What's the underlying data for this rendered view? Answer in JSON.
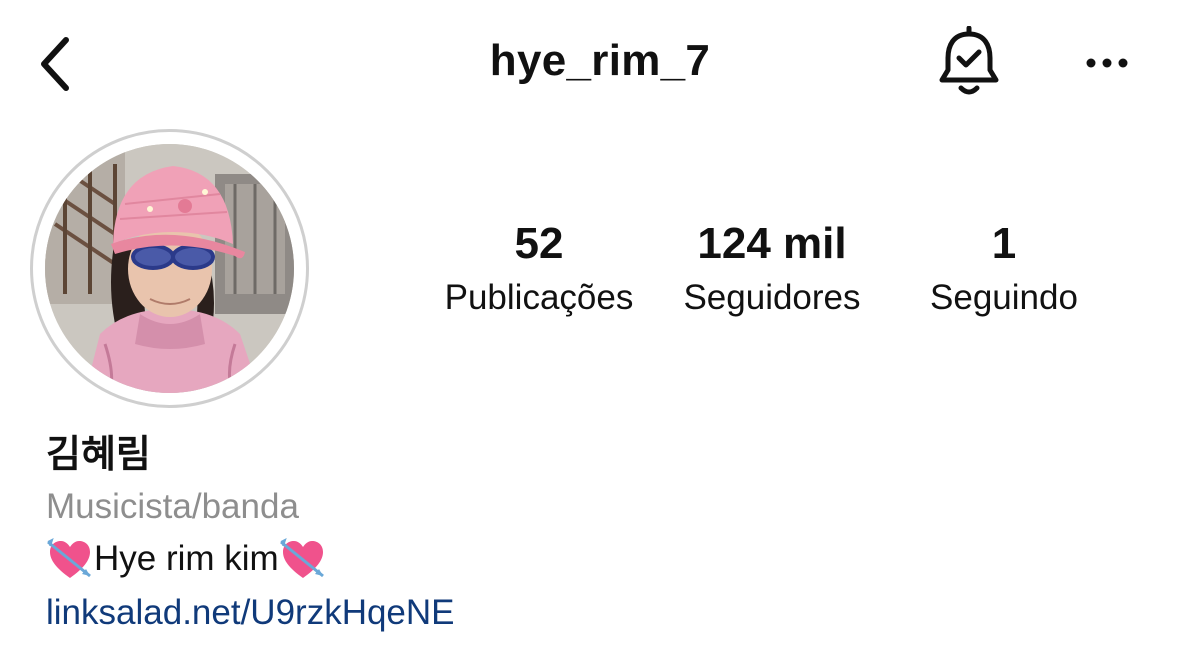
{
  "header": {
    "username": "hye_rim_7",
    "back_icon": "chevron-left-icon",
    "bell_icon": "bell-check-icon",
    "more_icon": "more-horizontal-icon"
  },
  "profile": {
    "avatar_icon": "profile-photo"
  },
  "stats": [
    {
      "value": "52",
      "label": "Publicações"
    },
    {
      "value": "124 mil",
      "label": "Seguidores"
    },
    {
      "value": "1",
      "label": "Seguindo"
    }
  ],
  "bio": {
    "full_name": "김혜림",
    "category": "Musicista/banda",
    "text": "Hye rim kim",
    "emoji_icon": "heart-with-arrow-icon",
    "link": "linksalad.net/U9rzkHqeNE"
  },
  "colors": {
    "text": "#111111",
    "secondary": "#8e8e8e",
    "link": "#103a7a",
    "ring": "#cfcfcf"
  }
}
